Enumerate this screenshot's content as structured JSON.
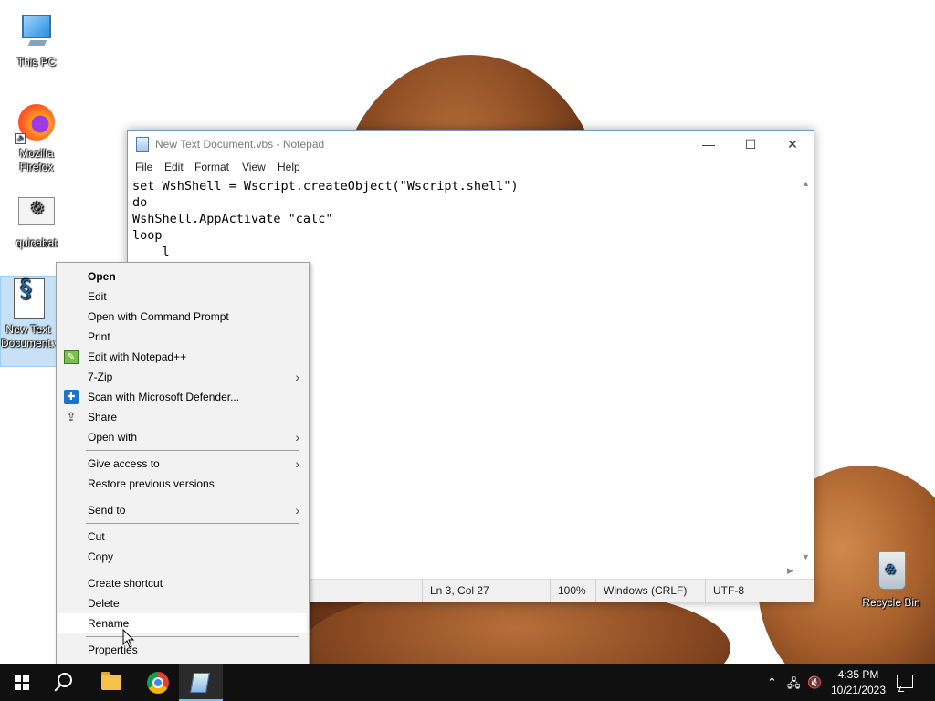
{
  "desktop": {
    "icons": [
      {
        "label": "This PC"
      },
      {
        "label": "Mozilla Firefox"
      },
      {
        "label": "quicabat"
      },
      {
        "label": "New Text Document.vbs"
      },
      {
        "label": "Recycle Bin"
      }
    ]
  },
  "notepad": {
    "title": "New Text Document.vbs - Notepad",
    "window_controls": {
      "minimize": "—",
      "maximize": "☐",
      "close": "✕"
    },
    "menu": [
      "File",
      "Edit",
      "Format",
      "View",
      "Help"
    ],
    "content": "set WshShell = Wscript.createObject(\"Wscript.shell\")\ndo\nWshShell.AppActivate \"calc\"\nloop\n    l",
    "status": {
      "position": "Ln 3, Col 27",
      "zoom": "100%",
      "line_endings": "Windows (CRLF)",
      "encoding": "UTF-8"
    }
  },
  "context_menu": {
    "items": [
      {
        "label": "Open",
        "bold": true
      },
      {
        "label": "Edit"
      },
      {
        "label": "Open with Command Prompt"
      },
      {
        "label": "Print"
      },
      {
        "label": "Edit with Notepad++",
        "icon": "notepad-plus-plus-icon"
      },
      {
        "label": "7-Zip",
        "submenu": true
      },
      {
        "label": "Scan with Microsoft Defender...",
        "icon": "defender-icon"
      },
      {
        "label": "Share",
        "icon": "share-icon"
      },
      {
        "label": "Open with",
        "submenu": true
      },
      {
        "label": "Give access to",
        "submenu": true
      },
      {
        "label": "Restore previous versions"
      },
      {
        "label": "Send to",
        "submenu": true
      },
      {
        "label": "Cut"
      },
      {
        "label": "Copy"
      },
      {
        "label": "Create shortcut"
      },
      {
        "label": "Delete"
      },
      {
        "label": "Rename",
        "hover": true
      },
      {
        "label": "Properties"
      }
    ]
  },
  "taskbar": {
    "clock_time": "4:35 PM",
    "clock_date": "10/21/2023",
    "pinned": [
      "start-button",
      "search-button",
      "file-explorer",
      "google-chrome",
      "notepad"
    ],
    "active_app": "notepad"
  },
  "colors": {
    "taskbar_bg": "#101010",
    "menu_bg": "#f2f2f2",
    "selection": "#99c9ef",
    "active_indicator": "#7ab7ff"
  }
}
